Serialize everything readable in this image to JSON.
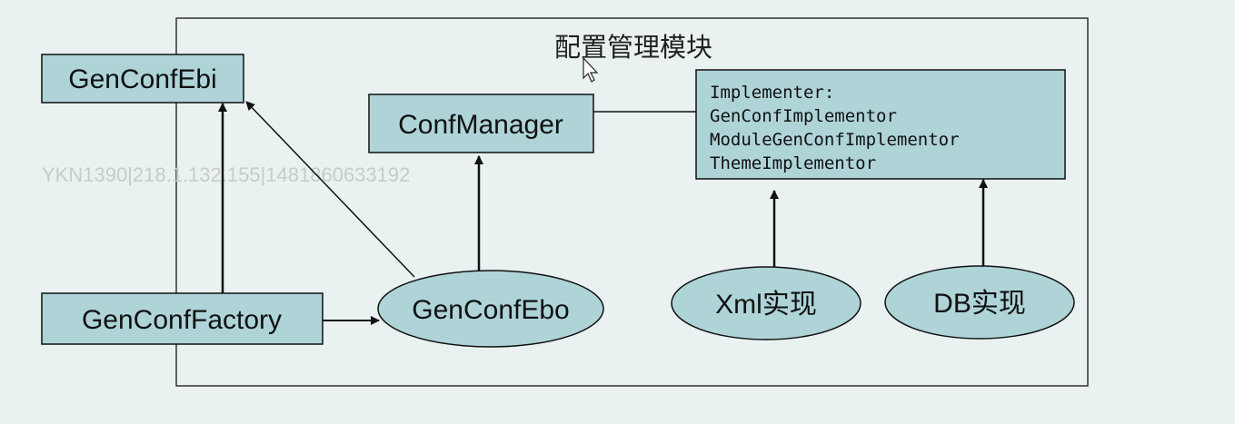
{
  "module": {
    "title": "配置管理模块"
  },
  "nodes": {
    "gen_conf_ebi": "GenConfEbi",
    "gen_conf_factory": "GenConfFactory",
    "conf_manager": "ConfManager",
    "gen_conf_ebo": "GenConfEbo",
    "xml_impl": "Xml实现",
    "db_impl": "DB实现",
    "implementer": {
      "lines": [
        "Implementer:",
        "GenConfImplementor",
        "ModuleGenConfImplementor",
        "ThemeImplementor"
      ]
    }
  },
  "watermark": "YKN1390|218.1.132.155|1481860633192",
  "colors": {
    "node_fill": "#aed4d8",
    "stroke": "#111111",
    "background": "#e9f1f1"
  }
}
